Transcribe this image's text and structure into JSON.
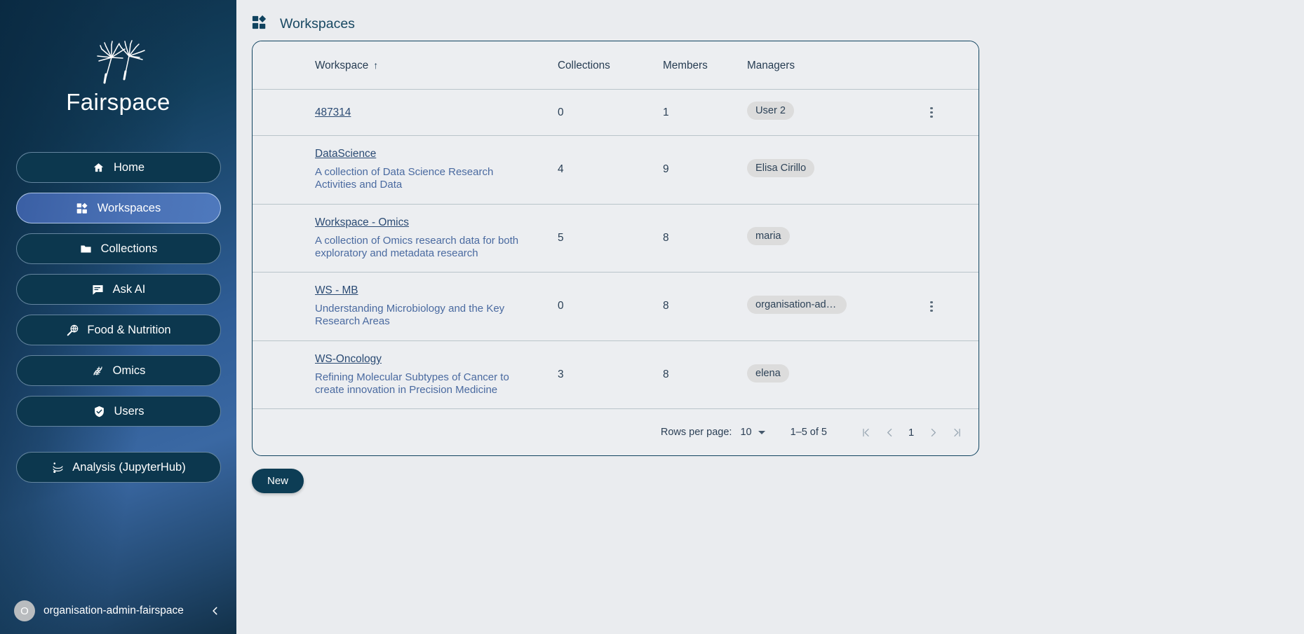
{
  "brand": {
    "name": "Fairspace",
    "logo_icon": "dandelion-icon"
  },
  "sidebar": {
    "items": [
      {
        "label": "Home",
        "icon": "home-icon",
        "active": false
      },
      {
        "label": "Workspaces",
        "icon": "dashboard-icon",
        "active": true
      },
      {
        "label": "Collections",
        "icon": "folder-icon",
        "active": false
      },
      {
        "label": "Ask AI",
        "icon": "chat-icon",
        "active": false
      },
      {
        "label": "Food & Nutrition",
        "icon": "magnifier-globe-icon",
        "active": false
      },
      {
        "label": "Omics",
        "icon": "dna-icon",
        "active": false
      },
      {
        "label": "Users",
        "icon": "shield-check-icon",
        "active": false
      },
      {
        "label": "Analysis (JupyterHub)",
        "icon": "jupyter-icon",
        "active": false
      }
    ],
    "footer": {
      "avatar_letter": "O",
      "user": "organisation-admin-fairspace",
      "collapse_icon": "chevron-left-icon"
    }
  },
  "header": {
    "title": "Workspaces",
    "icon": "dashboard-icon"
  },
  "table": {
    "columns": {
      "workspace": "Workspace",
      "collections": "Collections",
      "members": "Members",
      "managers": "Managers"
    },
    "sort_indicator": "↑",
    "rows": [
      {
        "name": "487314",
        "description": "",
        "collections": "0",
        "members": "1",
        "manager": "User 2",
        "has_menu": true
      },
      {
        "name": "DataScience",
        "description": "A collection of Data Science Research Activities and Data",
        "collections": "4",
        "members": "9",
        "manager": "Elisa Cirillo",
        "has_menu": false
      },
      {
        "name": "Workspace - Omics",
        "description": "A collection of Omics research data for both exploratory and metadata research",
        "collections": "5",
        "members": "8",
        "manager": "maria",
        "has_menu": false
      },
      {
        "name": "WS - MB",
        "description": "Understanding Microbiology and the Key Research Areas",
        "collections": "0",
        "members": "8",
        "manager": "organisation-admin…",
        "has_menu": true
      },
      {
        "name": "WS-Oncology",
        "description": "Refining Molecular Subtypes of Cancer to create innovation in Precision Medicine",
        "collections": "3",
        "members": "8",
        "manager": "elena",
        "has_menu": false
      }
    ]
  },
  "pagination": {
    "rows_per_page_label": "Rows per page:",
    "rows_per_page_value": "10",
    "range": "1–5 of 5",
    "current_page": "1",
    "first_icon": "first-page-icon",
    "prev_icon": "prev-page-icon",
    "next_icon": "next-page-icon",
    "last_icon": "last-page-icon"
  },
  "actions": {
    "new_label": "New"
  },
  "colors": {
    "sidebar_dark": "#0c2e47",
    "sidebar_blue": "#3a68a3",
    "nav_item": "#0c374e",
    "accent": "#0d3d55",
    "page_bg": "#eaecef",
    "link": "#2a4a73",
    "chip_bg": "#dcdcdc"
  }
}
